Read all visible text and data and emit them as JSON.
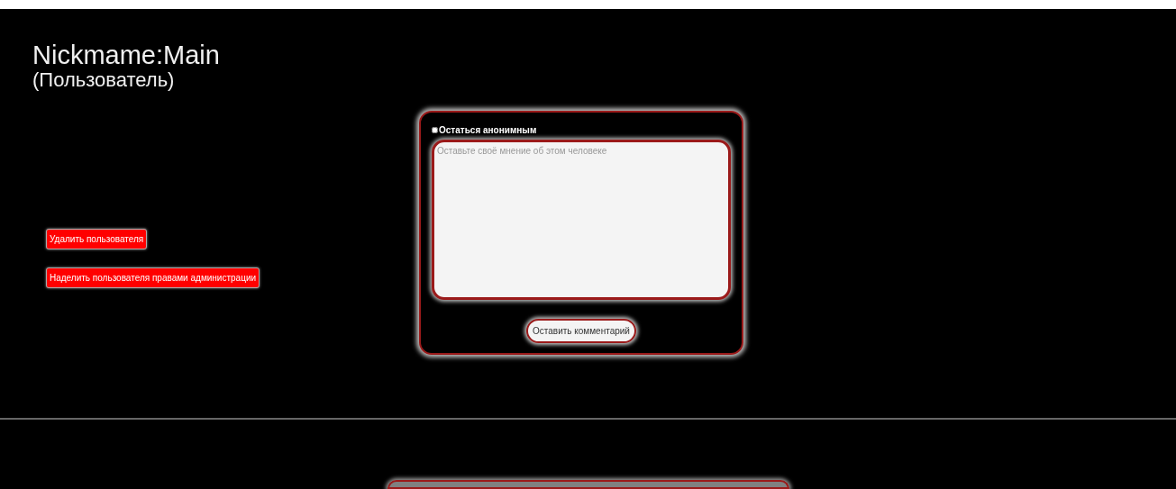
{
  "profile": {
    "nickname": "Nickmame:Main",
    "role": "(Пользователь)"
  },
  "admin_actions": [
    {
      "label": "Удалить пользователя"
    },
    {
      "label": "Наделить пользователя правами администрации"
    }
  ],
  "comment_form": {
    "anonymous": {
      "label": "Остаться анонимным",
      "checked": false
    },
    "comment_field": {
      "placeholder": "Оставьте своё мнение об этом человеке"
    },
    "submit_button": "Оставить комментарий"
  }
}
